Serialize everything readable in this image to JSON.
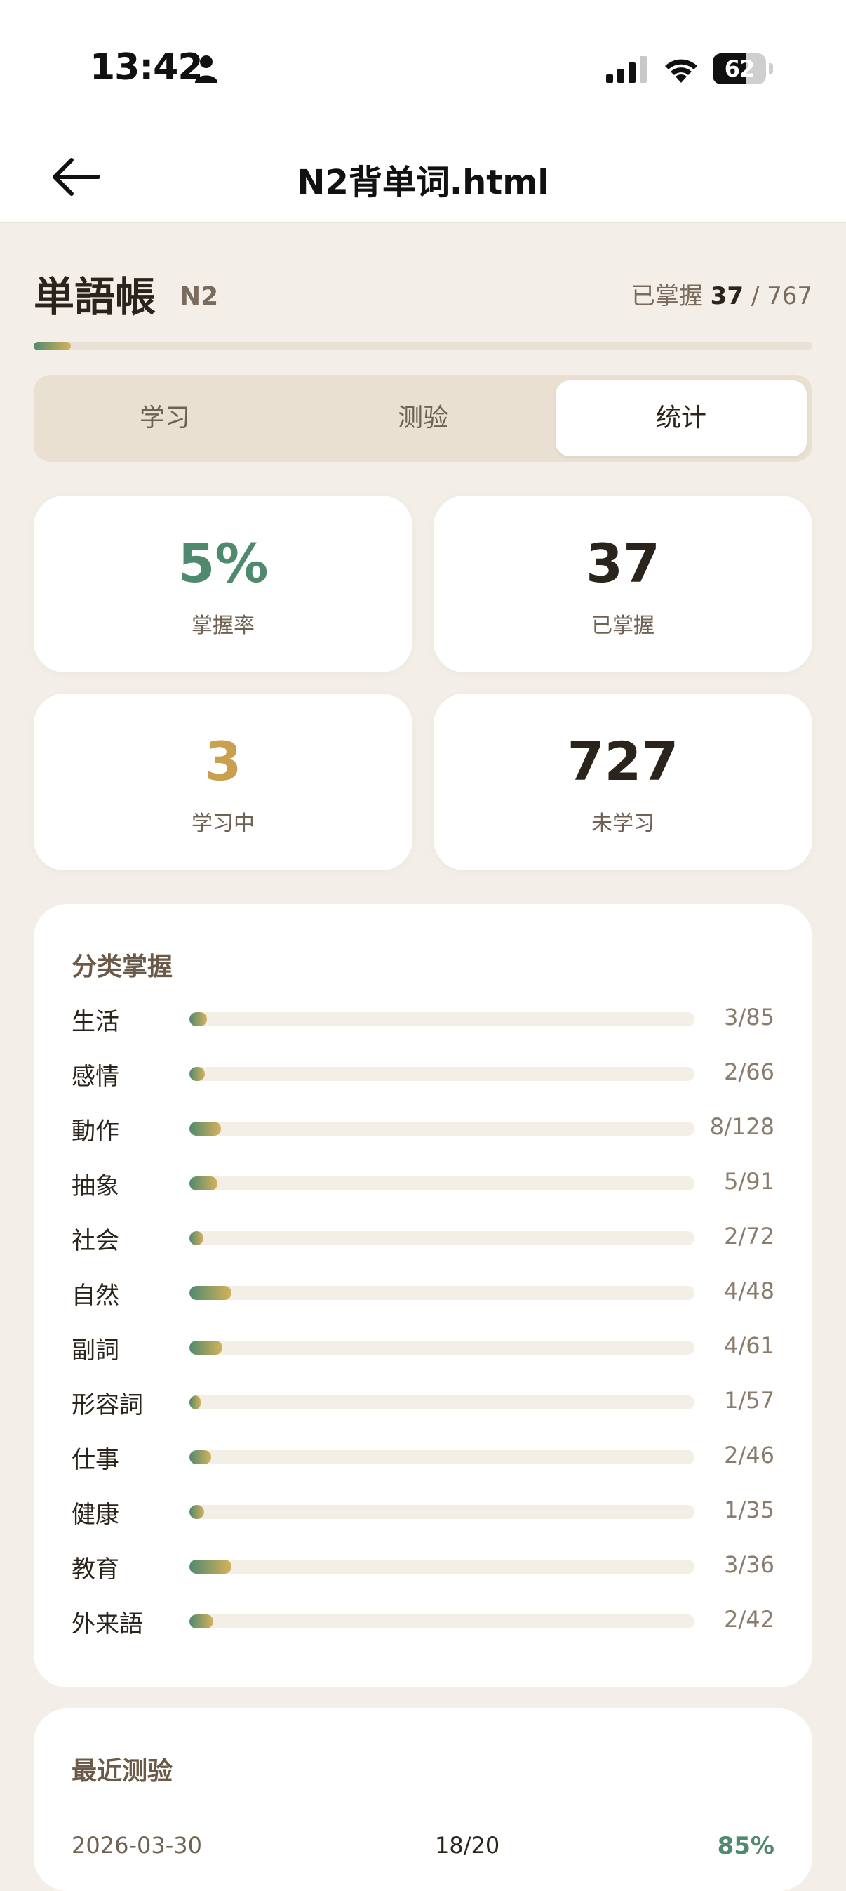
{
  "status_bar": {
    "time": "13:42",
    "battery": {
      "text": "62",
      "level": 0.62
    }
  },
  "nav": {
    "title": "N2背单词.html"
  },
  "header": {
    "title": "単語帳",
    "level": "N2",
    "mastered_label": "已掌握",
    "mastered_count": "37",
    "separator": "/",
    "total": "767",
    "progress_fraction": 0.048
  },
  "tabs": [
    {
      "label": "学习",
      "active": false
    },
    {
      "label": "测验",
      "active": false
    },
    {
      "label": "统计",
      "active": true
    }
  ],
  "stats": [
    {
      "value": "5%",
      "label": "掌握率",
      "color": "#4f8a6e"
    },
    {
      "value": "37",
      "label": "已掌握",
      "color": "#2b241c"
    },
    {
      "value": "3",
      "label": "学习中",
      "color": "#caa04f"
    },
    {
      "value": "727",
      "label": "未学习",
      "color": "#2b241c"
    }
  ],
  "categories": {
    "title": "分类掌握",
    "items": [
      {
        "name": "生活",
        "mastered": 3,
        "total": 85,
        "count": "3/85"
      },
      {
        "name": "感情",
        "mastered": 2,
        "total": 66,
        "count": "2/66"
      },
      {
        "name": "動作",
        "mastered": 8,
        "total": 128,
        "count": "8/128"
      },
      {
        "name": "抽象",
        "mastered": 5,
        "total": 91,
        "count": "5/91"
      },
      {
        "name": "社会",
        "mastered": 2,
        "total": 72,
        "count": "2/72"
      },
      {
        "name": "自然",
        "mastered": 4,
        "total": 48,
        "count": "4/48"
      },
      {
        "name": "副詞",
        "mastered": 4,
        "total": 61,
        "count": "4/61"
      },
      {
        "name": "形容詞",
        "mastered": 1,
        "total": 57,
        "count": "1/57"
      },
      {
        "name": "仕事",
        "mastered": 2,
        "total": 46,
        "count": "2/46"
      },
      {
        "name": "健康",
        "mastered": 1,
        "total": 35,
        "count": "1/35"
      },
      {
        "name": "教育",
        "mastered": 3,
        "total": 36,
        "count": "3/36"
      },
      {
        "name": "外来語",
        "mastered": 2,
        "total": 42,
        "count": "2/42"
      }
    ]
  },
  "recent": {
    "title": "最近测验",
    "rows": [
      {
        "date": "2026-03-30",
        "score": "18/20",
        "pct": "85%"
      }
    ]
  }
}
